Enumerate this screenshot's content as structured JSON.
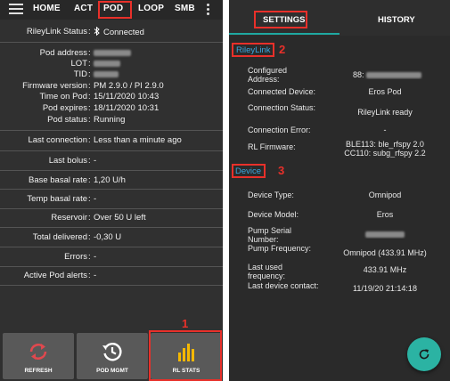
{
  "left": {
    "tabs": [
      "HOME",
      "ACT",
      "POD",
      "LOOP",
      "SMB"
    ],
    "rows": [
      {
        "label": "RileyLink Status",
        "value": "Connected",
        "icon": "bluetooth-icon"
      },
      {
        "label": "Pod address",
        "value": ""
      },
      {
        "label": "LOT",
        "value": ""
      },
      {
        "label": "TID",
        "value": ""
      },
      {
        "label": "Firmware version",
        "value": "PM 2.9.0 / PI 2.9.0"
      },
      {
        "label": "Time on Pod",
        "value": "15/11/2020 10:43"
      },
      {
        "label": "Pod expires",
        "value": "18/11/2020 10:31"
      },
      {
        "label": "Pod status",
        "value": "Running"
      },
      {
        "label": "Last connection",
        "value": "Less than a minute ago"
      },
      {
        "label": "Last bolus",
        "value": "-"
      },
      {
        "label": "Base basal rate",
        "value": "1,20 U/h"
      },
      {
        "label": "Temp basal rate",
        "value": "-"
      },
      {
        "label": "Reservoir",
        "value": "Over 50 U left"
      },
      {
        "label": "Total delivered",
        "value": "-0,30 U"
      },
      {
        "label": "Errors",
        "value": "-"
      },
      {
        "label": "Active Pod alerts",
        "value": "-"
      }
    ],
    "buttons": {
      "refresh": "REFRESH",
      "pod_mgmt": "POD MGMT",
      "rl_stats": "RL STATS"
    },
    "annotation_1": "1",
    "colors": {
      "refresh": "#e0484e",
      "pod_mgmt": "#ffffff",
      "rl_stats": "#f5b800",
      "highlight": "#e8302a"
    }
  },
  "right": {
    "tabs": [
      "SETTINGS",
      "HISTORY"
    ],
    "sections": [
      {
        "title": "RileyLink",
        "annotation": "2",
        "rows": [
          {
            "label": "Configured Address:",
            "value": "88:"
          },
          {
            "label": "Connected Device:",
            "value": "Eros Pod"
          },
          {
            "label": "Connection Status:",
            "value": "RileyLink ready"
          },
          {
            "label": "Connection Error:",
            "value": "-"
          },
          {
            "label": "RL Firmware:",
            "value": "BLE113: ble_rfspy 2.0\nCC110: subg_rfspy 2.2"
          }
        ]
      },
      {
        "title": "Device",
        "annotation": "3",
        "rows": [
          {
            "label": "Device Type:",
            "value": "Omnipod"
          },
          {
            "label": "Device Model:",
            "value": "Eros"
          },
          {
            "label": "Pump Serial Number:",
            "value": ""
          },
          {
            "label": "Pump Frequency:",
            "value": "Omnipod (433.91 MHz)"
          },
          {
            "label": "Last used frequency:",
            "value": "433.91 MHz"
          },
          {
            "label": "Last device contact:",
            "value": "11/19/20 21:14:18"
          }
        ]
      }
    ],
    "colors": {
      "accent": "#1fa8a1",
      "section_title": "#3aa7e0",
      "fab": "#2bb3a3"
    }
  }
}
